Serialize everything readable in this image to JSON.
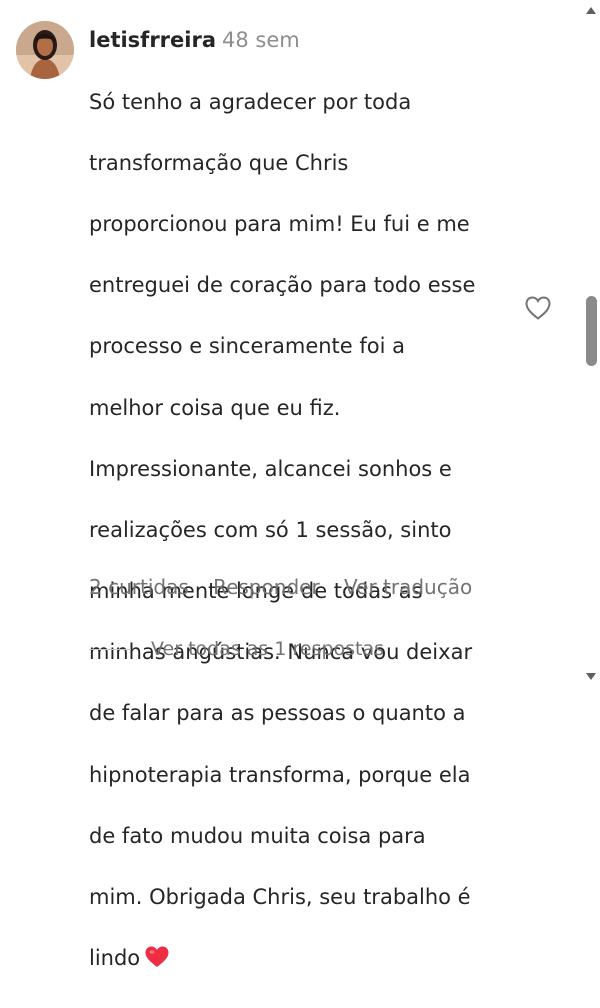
{
  "comment": {
    "username": "letisfrreira",
    "time": "48 sem",
    "lines": [
      "Só tenho a agradecer por toda",
      "transformação que Chris",
      "proporcionou para mim! Eu fui e me",
      "entreguei de coração para todo esse",
      "processo e sinceramente foi a",
      "melhor coisa que eu fiz.",
      "Impressionante, alcancei sonhos e",
      "realizações com só 1 sessão, sinto",
      "minha mente longe de todas as",
      "minhas angústias. Nunca vou deixar",
      "de falar para as pessoas o quanto a",
      "hipnoterapia transforma, porque ela",
      "de fato mudou muita coisa para",
      "mim. Obrigada Chris, seu trabalho é",
      "lindo"
    ],
    "emoji": "red-heart-emoji",
    "like_icon": "heart-outline-icon"
  },
  "actions": {
    "likes": "2 curtidas",
    "reply": "Responder",
    "translate": "Ver tradução"
  },
  "replies": {
    "label": "Ver todas as 1 respostas"
  },
  "colors": {
    "text": "#262626",
    "muted": "#737373",
    "time": "#8e8e8e",
    "heart": "#ed2d43"
  }
}
